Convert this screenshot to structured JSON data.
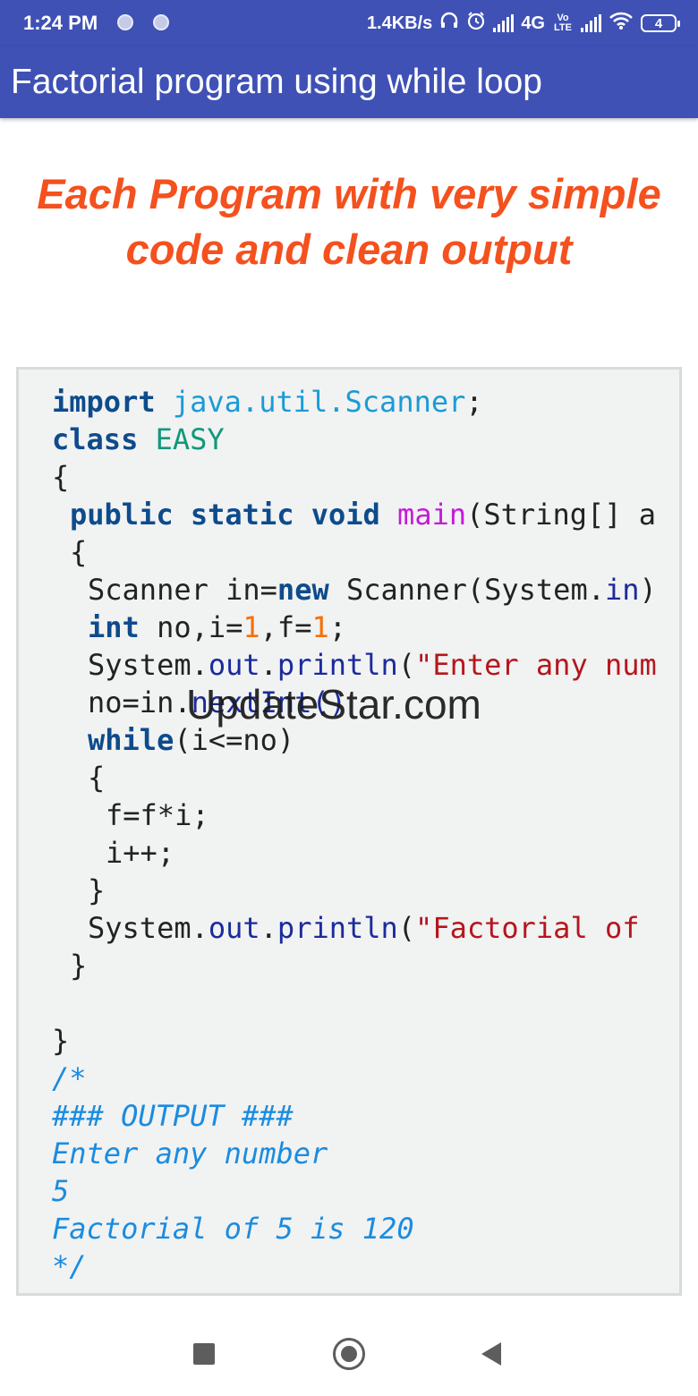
{
  "status_bar": {
    "time": "1:24 PM",
    "net_speed": "1.4KB/s",
    "network": "4G",
    "volte": "Vo LTE",
    "battery": "4"
  },
  "app_bar": {
    "title": "Factorial program using while loop"
  },
  "tagline": {
    "line1": "Each Program with very simple",
    "line2": "code and  clean output"
  },
  "watermark": "UpdateStar.com",
  "code": {
    "import_kw": "import",
    "import_pkg": "java.util.Scanner",
    "semicolon": ";",
    "class_kw": "class",
    "class_name": "EASY",
    "open_brace": "{",
    "close_brace": "}",
    "main_mods": "public static void",
    "main_name": "main",
    "main_args": "(String[] a",
    "scanner_decl": "Scanner in=",
    "new_kw": "new",
    "scanner_ctor": " Scanner(System.",
    "sys_in": "in",
    "paren_close": ")",
    "int_kw": "int",
    "int_decl_a": " no,i=",
    "one": "1",
    "int_decl_b": ",f=",
    "sys_prefix": "System.",
    "out": "out",
    "dot": ".",
    "println": "println",
    "paren_open": "(",
    "enter_str": "\"Enter any num",
    "read_a": "no=in.",
    "read_b": "nextInt()",
    "while_kw": "while",
    "while_cond": "(i<=no)",
    "mul": "f=f*i;",
    "inc": "i++;",
    "fact_str": "\"Factorial of",
    "comment": [
      "/*",
      "### OUTPUT ###",
      "Enter any number",
      "5",
      "Factorial of 5 is 120",
      "*/"
    ]
  }
}
